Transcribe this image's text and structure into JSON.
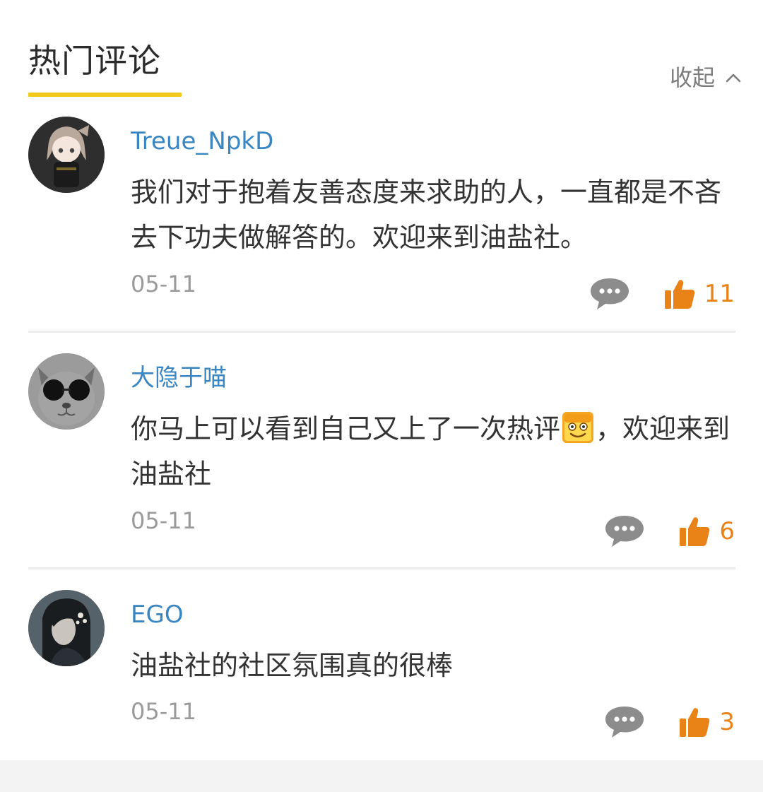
{
  "header": {
    "title": "热门评论",
    "collapse_label": "收起",
    "accent_color": "#f2c81a"
  },
  "colors": {
    "username": "#3a86c3",
    "like": "#e98318",
    "muted": "#9a9a9a"
  },
  "comments": [
    {
      "username": "Treue_NpkD",
      "content": "我们对于抱着友善态度来求助的人，一直都是不吝去下功夫做解答的。欢迎来到油盐社。",
      "date": "05-11",
      "likes": "11",
      "avatar": "anime-girl-avatar"
    },
    {
      "username": "大隐于喵",
      "content_before_emoji": "你马上可以看到自己又上了一次热评",
      "emoji": "smile-emoji",
      "content_after_emoji": "，欢迎来到油盐社",
      "date": "05-11",
      "likes": "6",
      "avatar": "cat-with-sunglasses-avatar"
    },
    {
      "username": "EGO",
      "content": "油盐社的社区氛围真的很棒",
      "date": "05-11",
      "likes": "3",
      "avatar": "woman-portrait-avatar"
    }
  ]
}
